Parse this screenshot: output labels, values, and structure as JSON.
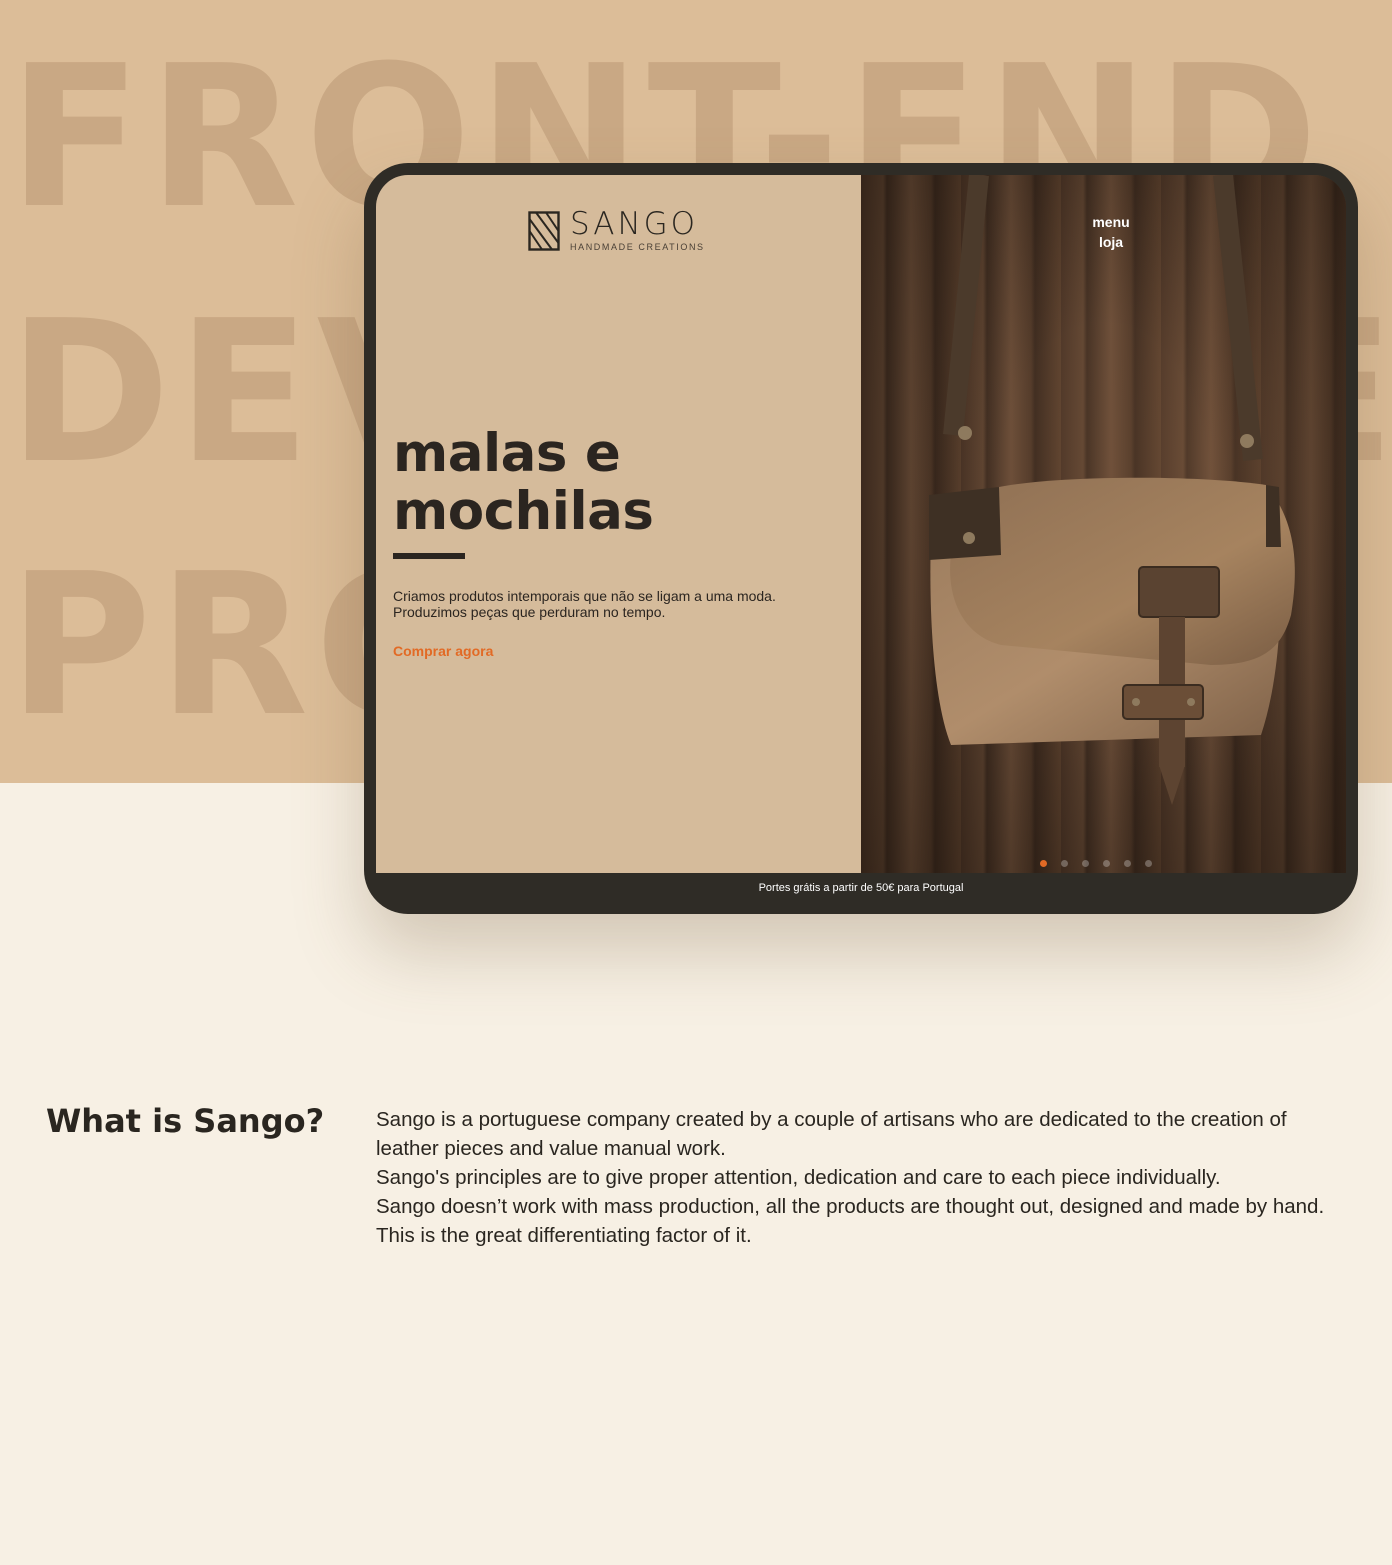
{
  "background": {
    "words": [
      "FRONT-END",
      "DEVELOPMENT",
      "PROJECT"
    ]
  },
  "site": {
    "logo": {
      "name": "SANGO",
      "tagline": "HANDMADE CREATIONS"
    },
    "nav": {
      "menu": "menu",
      "shop": "loja"
    },
    "hero": {
      "title": "malas e mochilas",
      "description_line1": "Criamos produtos intemporais que não se ligam a uma moda.",
      "description_line2": "Produzimos peças que perduram no tempo.",
      "cta": "Comprar agora"
    },
    "carousel": {
      "slides": 6,
      "active": 1
    },
    "shipping_note": "Portes grátis a partir de 50€ para Portugal"
  },
  "about": {
    "title": "What is Sango?",
    "paragraphs": [
      "Sango is a portuguese company created by a couple of artisans who are dedicated to the creation of leather pieces and value manual work.",
      "Sango's principles are to give proper attention, dedication and care to each piece individually.",
      "Sango doesn’t work with mass production, all the products are thought out, designed and made by hand. This is the great differentiating factor of it."
    ]
  },
  "colors": {
    "band": "#dcbd98",
    "page": "#f7f0e4",
    "device": "#2f2c26",
    "panel": "#d5bb9b",
    "accent": "#e26a25"
  }
}
